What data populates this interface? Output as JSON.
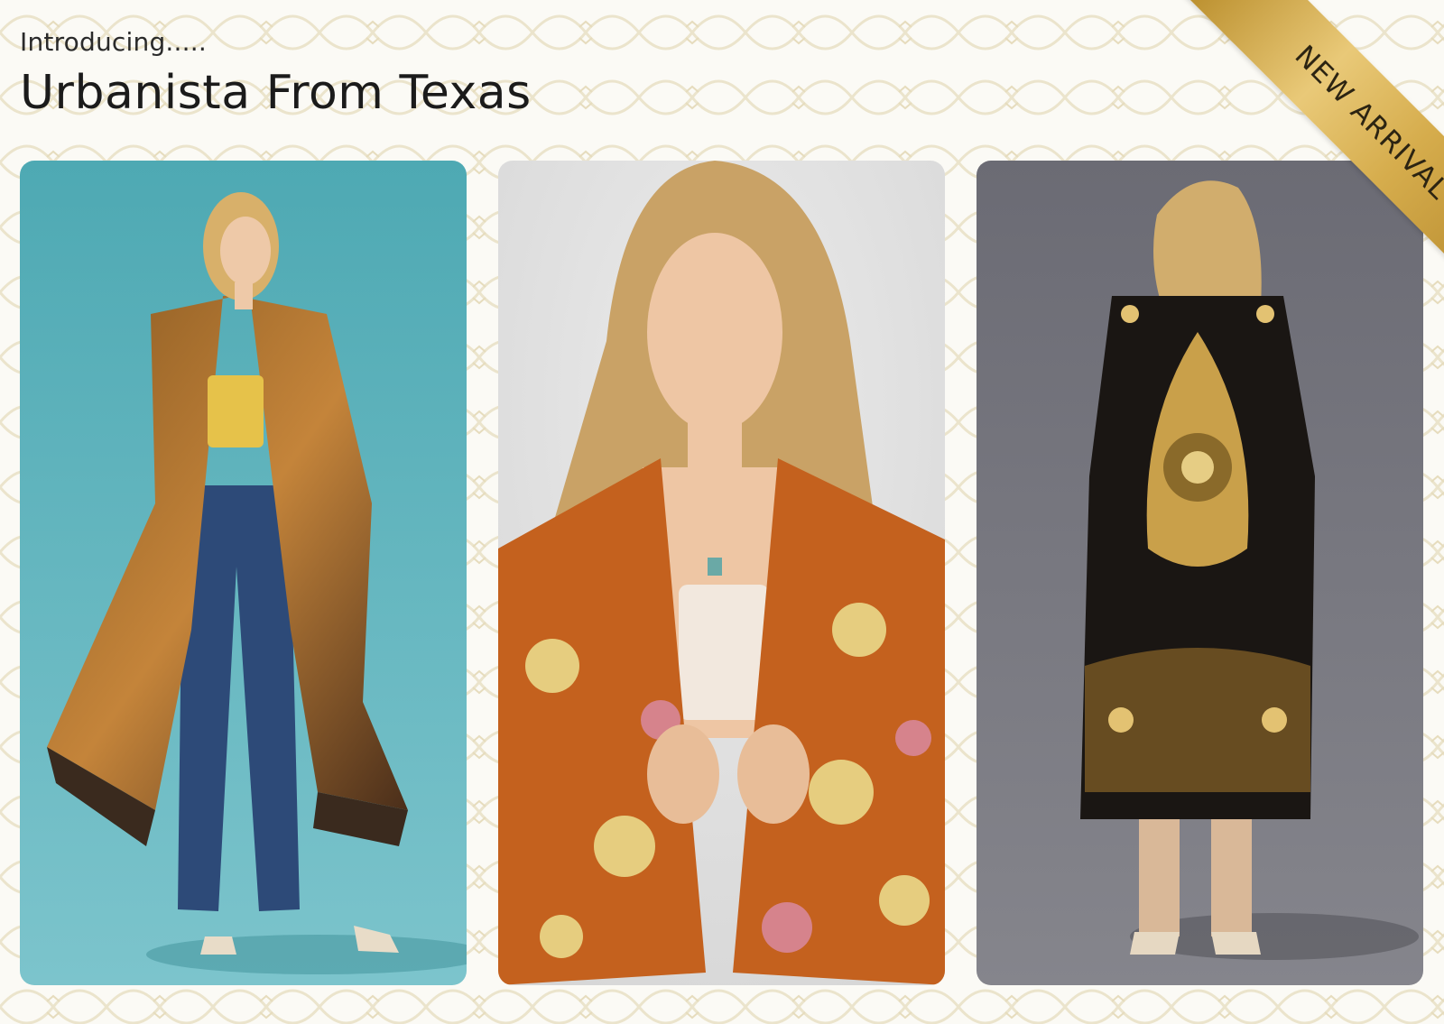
{
  "header": {
    "eyebrow": "Introducing.....",
    "title": "Urbanista From Texas"
  },
  "badge": {
    "label": "NEW ARRIVAL"
  },
  "colors": {
    "background": "#fbfaf5",
    "pattern": "#e8e0c4",
    "ribbon_gold": "#d6ad4d",
    "card1_bg": "#5fb3ba",
    "card2_bg": "#e3e3e3",
    "card3_bg": "#707078"
  },
  "products": [
    {
      "icon": "model-long-fringe-kimono-photo"
    },
    {
      "icon": "model-orange-floral-kimono-photo"
    },
    {
      "icon": "model-black-gold-paisley-kimono-photo"
    }
  ]
}
